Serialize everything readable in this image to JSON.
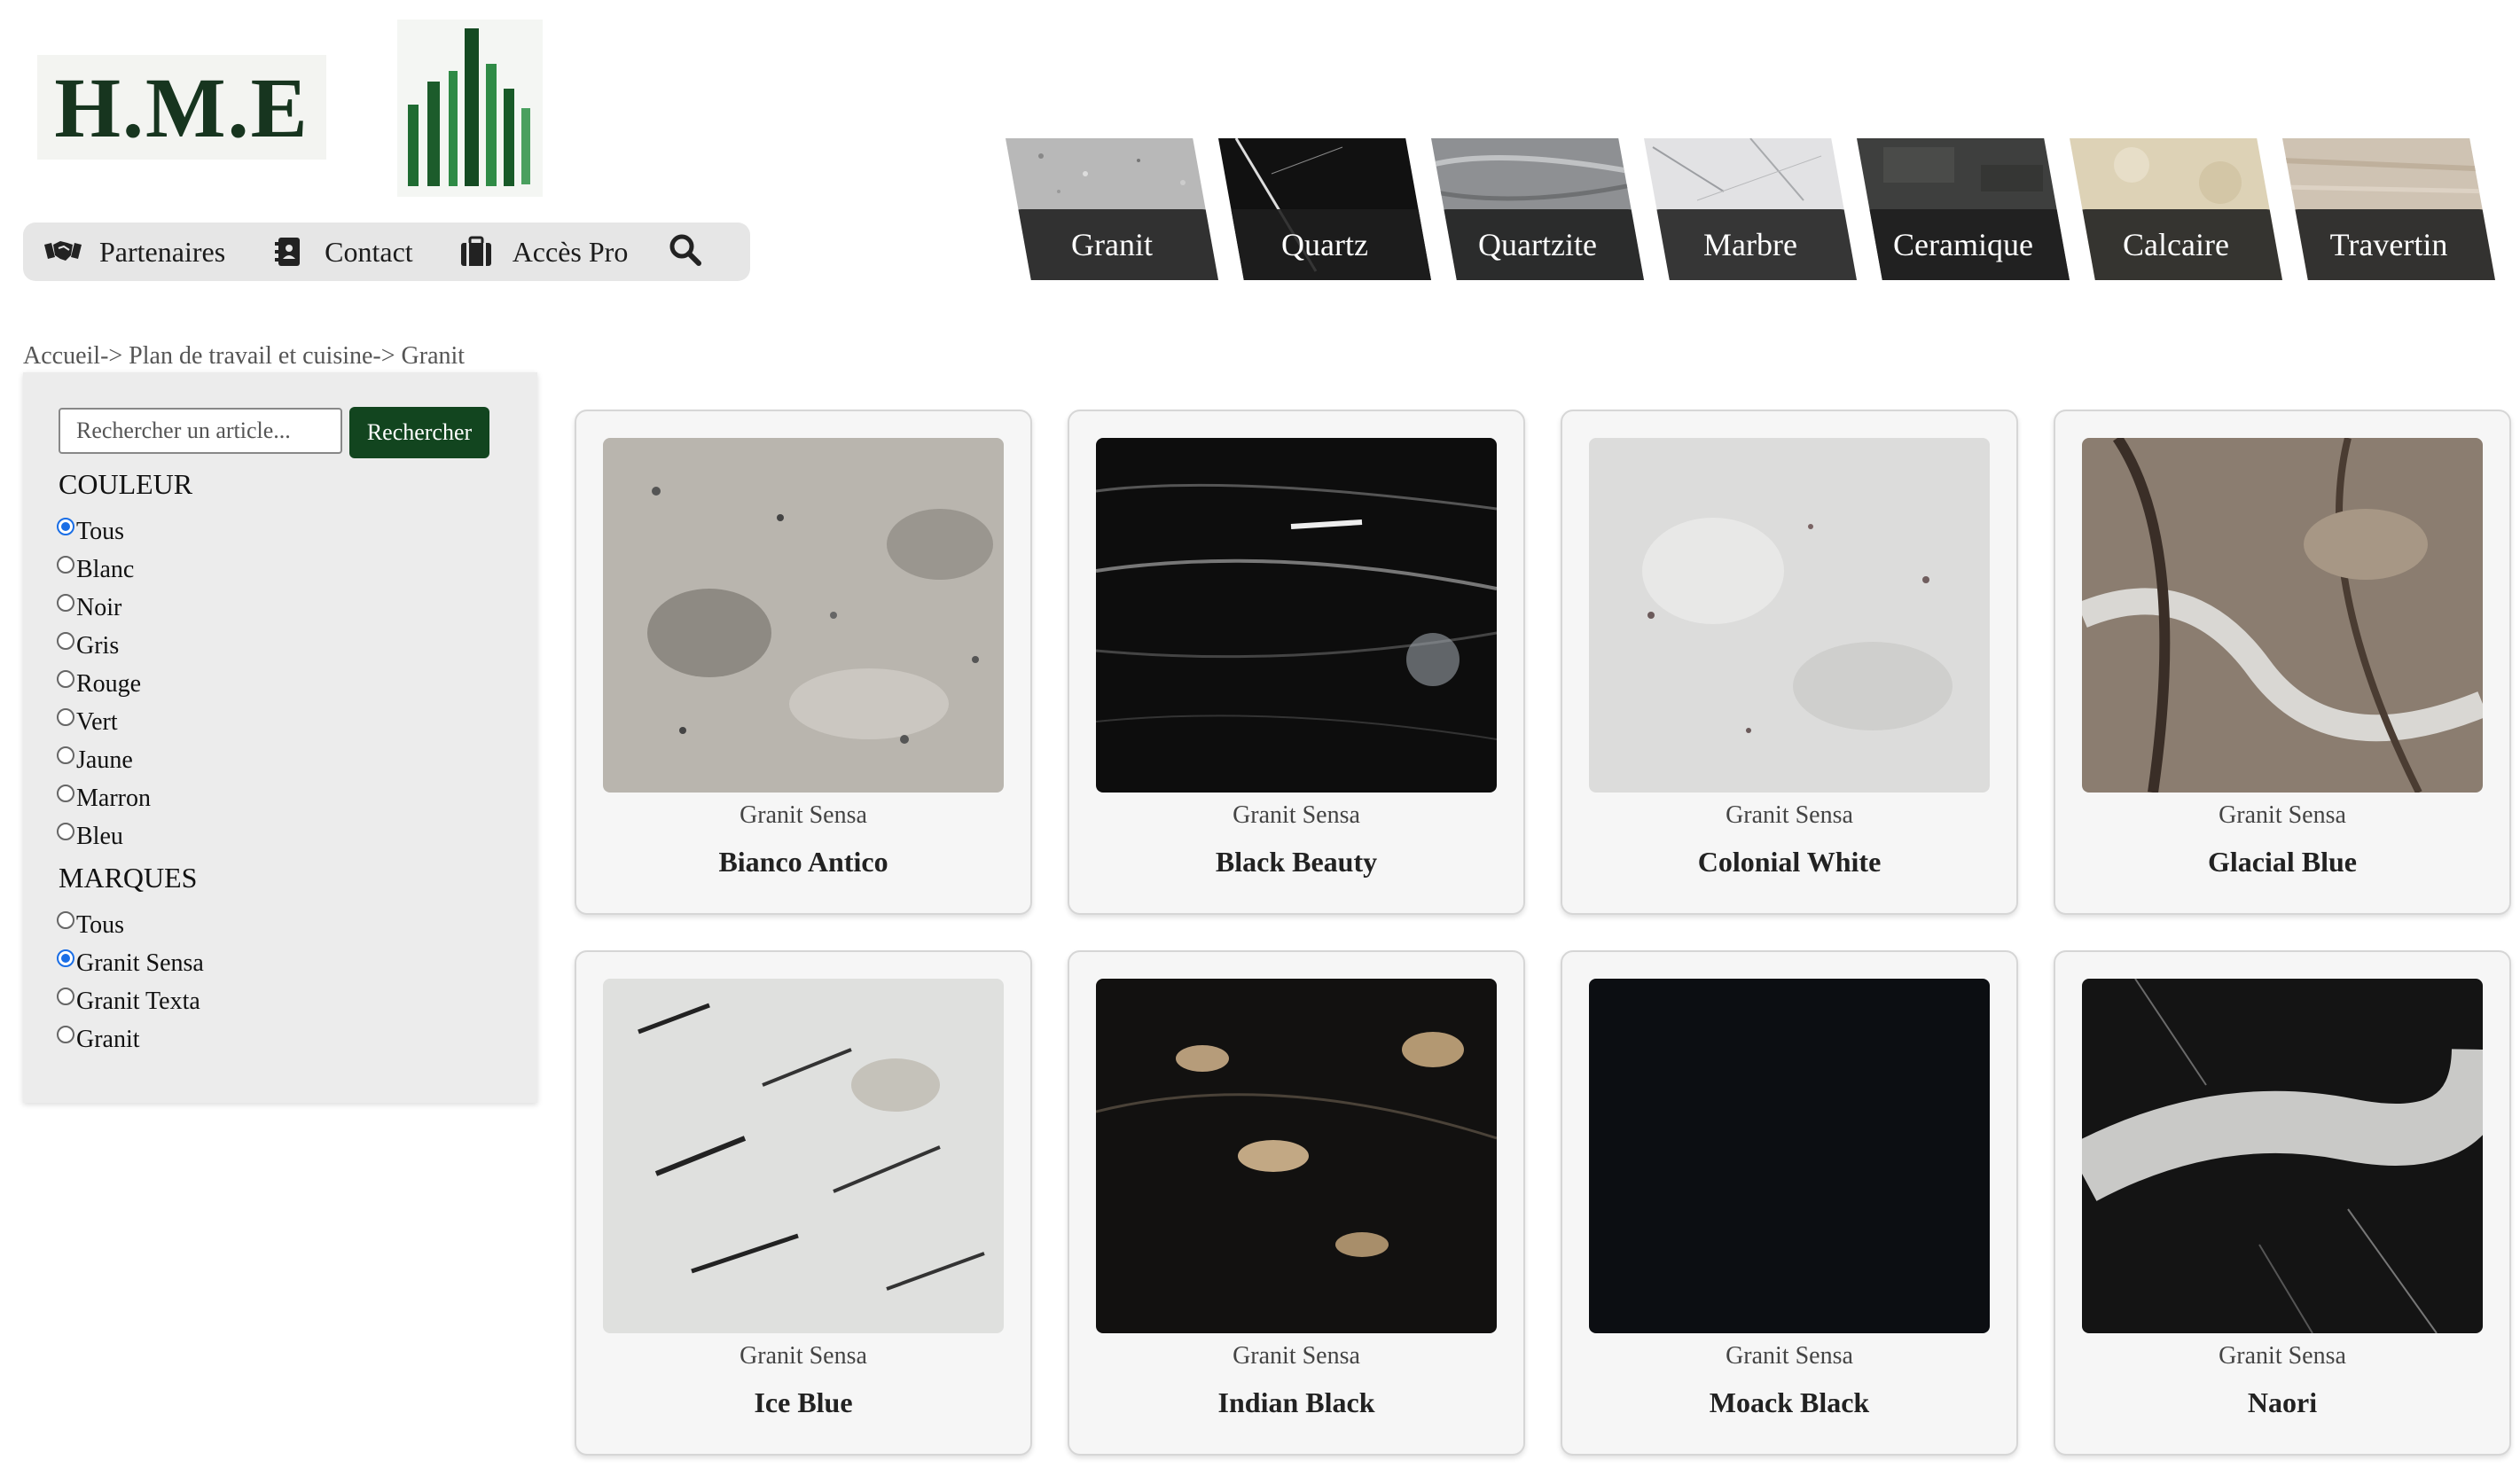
{
  "logo": {
    "text": "H.M.E"
  },
  "nav": {
    "items": [
      {
        "label": "Partenaires",
        "icon": "handshake-icon"
      },
      {
        "label": "Contact",
        "icon": "contact-card-icon"
      },
      {
        "label": "Accès Pro",
        "icon": "briefcase-icon"
      }
    ],
    "search_icon": "search-icon"
  },
  "categories": [
    "Granit",
    "Quartz",
    "Quartzite",
    "Marbre",
    "Ceramique",
    "Calcaire",
    "Travertin"
  ],
  "breadcrumb": "Accueil-> Plan de travail et cuisine-> Granit",
  "sidebar": {
    "search_placeholder": "Rechercher un article...",
    "search_button": "Rechercher",
    "colour_title": "COULEUR",
    "colours": [
      "Tous",
      "Blanc",
      "Noir",
      "Gris",
      "Rouge",
      "Vert",
      "Jaune",
      "Marron",
      "Bleu"
    ],
    "colour_selected": "Tous",
    "brand_title": "MARQUES",
    "brands": [
      "Tous",
      "Granit Sensa",
      "Granit Texta",
      "Granit"
    ],
    "brand_selected": "Granit Sensa"
  },
  "products": [
    {
      "brand": "Granit Sensa",
      "name": "Bianco Antico"
    },
    {
      "brand": "Granit Sensa",
      "name": "Black Beauty"
    },
    {
      "brand": "Granit Sensa",
      "name": "Colonial White"
    },
    {
      "brand": "Granit Sensa",
      "name": "Glacial Blue"
    },
    {
      "brand": "Granit Sensa",
      "name": "Ice Blue"
    },
    {
      "brand": "Granit Sensa",
      "name": "Indian Black"
    },
    {
      "brand": "Granit Sensa",
      "name": "Moack Black"
    },
    {
      "brand": "Granit Sensa",
      "name": "Naori"
    }
  ],
  "colors": {
    "accent_button": "#12451f",
    "radio_checked": "#1a6ee6"
  }
}
